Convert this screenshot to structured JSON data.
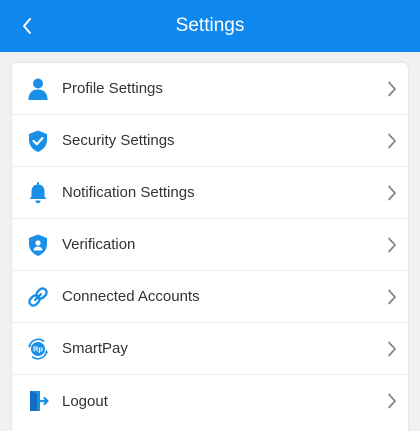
{
  "header": {
    "title": "Settings",
    "back_icon": "chevron-left-icon"
  },
  "colors": {
    "accent": "#0e88ee",
    "icon": "#1a8fe8",
    "text": "#333333",
    "chevron": "#888888",
    "background": "#f1f1f1"
  },
  "menu": {
    "items": [
      {
        "label": "Profile Settings",
        "icon": "person-icon"
      },
      {
        "label": "Security Settings",
        "icon": "shield-check-icon"
      },
      {
        "label": "Notification Settings",
        "icon": "bell-icon"
      },
      {
        "label": "Verification",
        "icon": "shield-user-icon"
      },
      {
        "label": "Connected Accounts",
        "icon": "link-icon"
      },
      {
        "label": "SmartPay",
        "icon": "smartpay-rp-icon",
        "icon_text": "Rp"
      },
      {
        "label": "Logout",
        "icon": "logout-door-icon"
      }
    ]
  }
}
